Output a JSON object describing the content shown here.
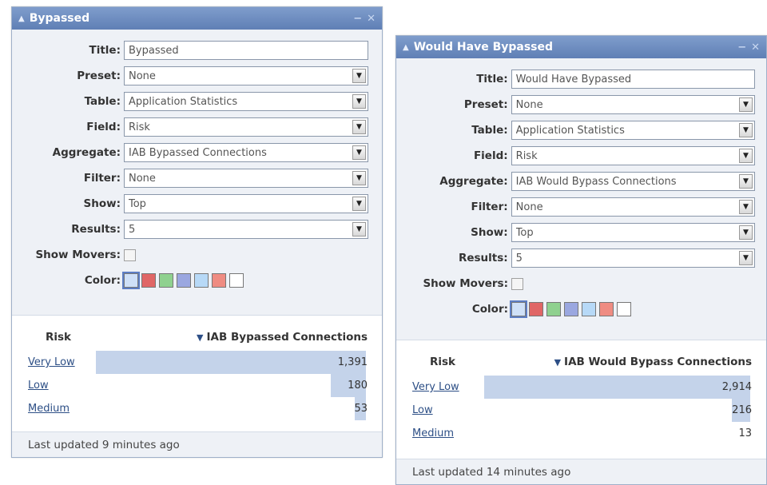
{
  "widgets": [
    {
      "title": "Bypassed",
      "form": {
        "title_label": "Title:",
        "title_value": "Bypassed",
        "preset_label": "Preset:",
        "preset_value": "None",
        "table_label": "Table:",
        "table_value": "Application Statistics",
        "field_label": "Field:",
        "field_value": "Risk",
        "aggregate_label": "Aggregate:",
        "aggregate_value": "IAB Bypassed Connections",
        "filter_label": "Filter:",
        "filter_value": "None",
        "show_label": "Show:",
        "show_value": "Top",
        "results_label": "Results:",
        "results_value": "5",
        "movers_label": "Show Movers:",
        "color_label": "Color:"
      },
      "colors": [
        "#cfe0f7",
        "#e06666",
        "#8fd18f",
        "#9aa7e0",
        "#b7d9f7",
        "#ef8c82",
        "#ffffff"
      ],
      "table": {
        "col1": "Risk",
        "col2": "IAB Bypassed Connections",
        "rows": [
          {
            "name": "Very Low",
            "value": "1,391",
            "share": 1.0
          },
          {
            "name": "Low",
            "value": "180",
            "share": 0.13
          },
          {
            "name": "Medium",
            "value": "53",
            "share": 0.04
          }
        ]
      },
      "footer": "Last updated 9 minutes ago"
    },
    {
      "title": "Would Have Bypassed",
      "form": {
        "title_label": "Title:",
        "title_value": "Would Have Bypassed",
        "preset_label": "Preset:",
        "preset_value": "None",
        "table_label": "Table:",
        "table_value": "Application Statistics",
        "field_label": "Field:",
        "field_value": "Risk",
        "aggregate_label": "Aggregate:",
        "aggregate_value": "IAB Would Bypass Connections",
        "filter_label": "Filter:",
        "filter_value": "None",
        "show_label": "Show:",
        "show_value": "Top",
        "results_label": "Results:",
        "results_value": "5",
        "movers_label": "Show Movers:",
        "color_label": "Color:"
      },
      "colors": [
        "#cfe0f7",
        "#e06666",
        "#8fd18f",
        "#9aa7e0",
        "#b7d9f7",
        "#ef8c82",
        "#ffffff"
      ],
      "table": {
        "col1": "Risk",
        "col2": "IAB Would Bypass Connections",
        "rows": [
          {
            "name": "Very Low",
            "value": "2,914",
            "share": 1.0
          },
          {
            "name": "Low",
            "value": "216",
            "share": 0.07
          },
          {
            "name": "Medium",
            "value": "13",
            "share": 0.0
          }
        ]
      },
      "footer": "Last updated 14 minutes ago"
    }
  ],
  "icons": {
    "collapse": "caret-up-icon",
    "minimize": "minimize-icon",
    "close": "close-icon",
    "dropdown": "dropdown-arrow-icon",
    "sort": "sort-desc-icon"
  }
}
